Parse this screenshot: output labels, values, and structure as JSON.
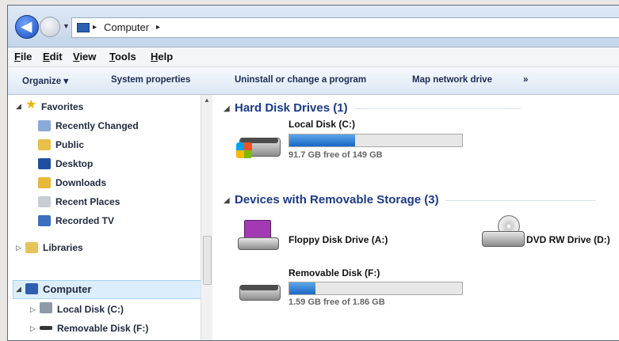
{
  "address": {
    "breadcrumb": "Computer",
    "sep": "▸"
  },
  "menu": {
    "file": "File",
    "edit": "Edit",
    "view": "View",
    "tools": "Tools",
    "help": "Help"
  },
  "toolbar": {
    "organize": "Organize ▾",
    "system_properties": "System properties",
    "uninstall": "Uninstall or change a program",
    "map_drive": "Map network drive",
    "more": "»"
  },
  "nav": {
    "favorites": "Favorites",
    "recently_changed": "Recently Changed",
    "public": "Public",
    "desktop": "Desktop",
    "downloads": "Downloads",
    "recent_places": "Recent Places",
    "recorded_tv": "Recorded TV",
    "libraries": "Libraries",
    "computer": "Computer",
    "local_disk": "Local Disk (C:)",
    "removable_disk": "Removable Disk (F:)"
  },
  "groups": {
    "hard_disk": "Hard Disk Drives (1)",
    "removable": "Devices with Removable Storage (3)"
  },
  "drives": {
    "c": {
      "name": "Local Disk (C:)",
      "free": "91.7 GB free of 149 GB",
      "used_fraction": 0.38
    },
    "a": {
      "name": "Floppy Disk Drive (A:)"
    },
    "d": {
      "name": "DVD RW Drive (D:)"
    },
    "f": {
      "name": "Removable Disk (F:)",
      "free": "1.59 GB free of 1.86 GB",
      "used_fraction": 0.15
    }
  },
  "colors": {
    "bar_fill": "#1b68c4",
    "group_heading": "#1b3a8a",
    "selection": "#dceefc"
  }
}
